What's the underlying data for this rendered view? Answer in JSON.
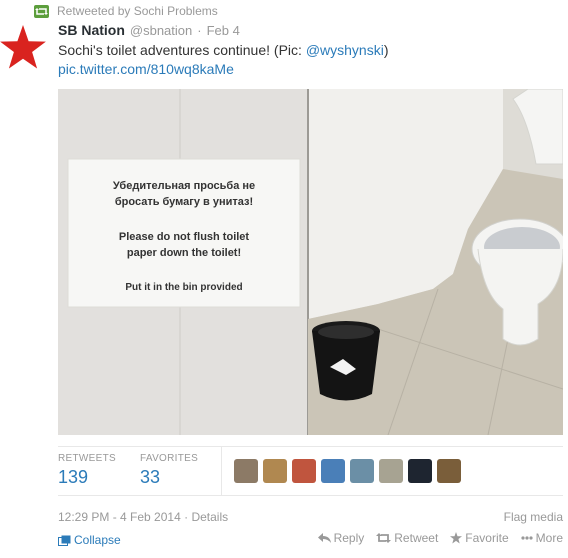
{
  "retweet": {
    "label": "Retweeted by Sochi Problems"
  },
  "tweet": {
    "name": "SB Nation",
    "handle": "@sbnation",
    "separator": "·",
    "date": "Feb 4",
    "text": "Sochi's toilet adventures continue! (Pic: ",
    "mention": "@wyshynski",
    "text_end": ")",
    "link": "pic.twitter.com/810wq8kaMe"
  },
  "photo": {
    "sign_ru_1": "Убедительная просьба не",
    "sign_ru_2": "бросать бумагу в унитаз!",
    "sign_en_1": "Please do not flush toilet",
    "sign_en_2": "paper down the toilet!",
    "sign_en_3": "Put it in the bin provided"
  },
  "stats": {
    "retweets_label": "RETWEETS",
    "retweets_value": "139",
    "favorites_label": "FAVORITES",
    "favorites_value": "33"
  },
  "footer": {
    "timestamp": "12:29 PM - 4 Feb 2014",
    "sep": "·",
    "details": "Details",
    "flag": "Flag media",
    "collapse": "Collapse",
    "reply": "Reply",
    "retweet": "Retweet",
    "favorite": "Favorite",
    "more": "More"
  },
  "colors": {
    "link": "#2b7bb9",
    "star": "#d9231f",
    "retweet_green": "#5c9e3c"
  },
  "icons": [
    "retweet-icon",
    "red-star-avatar",
    "reply-icon",
    "retweet-action-icon",
    "favorite-star-icon",
    "more-dots-icon",
    "collapse-icon"
  ]
}
